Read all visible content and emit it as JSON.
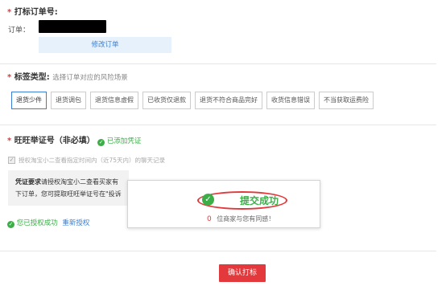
{
  "order_section": {
    "title": "打标订单号:",
    "order_label": "订单：",
    "edit_button": "修改订单"
  },
  "tag_section": {
    "title": "标签类型:",
    "subtitle": "选择订单对应的风险场景",
    "tags": [
      "退货少件",
      "退货调包",
      "退货信息虚假",
      "已收货仅退款",
      "退货不符合商品完好",
      "收货信息错误",
      "不当获取运费险"
    ]
  },
  "evidence_section": {
    "title": "旺旺举证号（非必填）",
    "added_status": "已添加凭证",
    "authorize_checkbox_label": "授权淘宝小二查看指定时间内（近75天内）的聊天记录",
    "requirement_label": "凭证要求",
    "requirement_line1": "请授权淘宝小二查看买家有",
    "requirement_line2": "下订单，您可提取旺旺举证号在\"投诉",
    "authorized_status": "您已授权成功",
    "reauthorize_link": "重新授权"
  },
  "modal": {
    "title": "提交成功",
    "count": "0",
    "message": "位商家与您有同感！"
  },
  "confirm_button": "确认打标",
  "colors": {
    "accent_red": "#e4393c",
    "link_blue": "#3a7fd5",
    "success_green": "#3bae48"
  }
}
